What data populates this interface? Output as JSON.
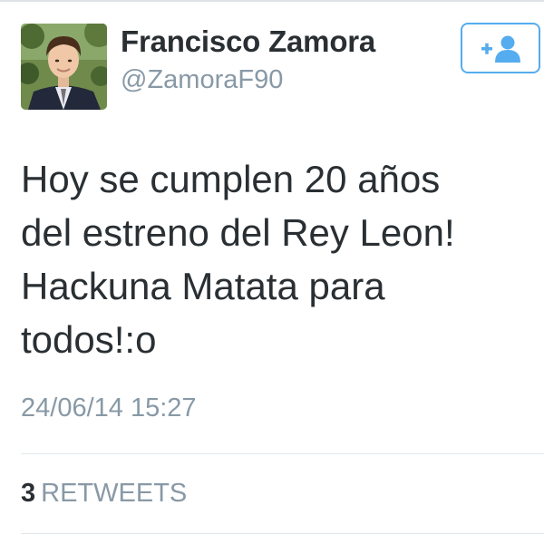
{
  "profile": {
    "name": "Francisco Zamora",
    "handle": "@ZamoraF90",
    "avatar_icon": "profile-photo"
  },
  "follow_button": {
    "icon": "add-user-icon",
    "accent_color": "#55acee"
  },
  "tweet": {
    "text": "Hoy se cumplen 20 años\ndel estreno del Rey Leon!\nHackuna Matata para\ntodos!:o",
    "timestamp": "24/06/14 15:27"
  },
  "stats": {
    "retweet_count": "3",
    "retweet_label": "RETWEETS"
  },
  "colors": {
    "text": "#292f33",
    "muted": "#8899a6",
    "divider": "#e1e8ed"
  }
}
